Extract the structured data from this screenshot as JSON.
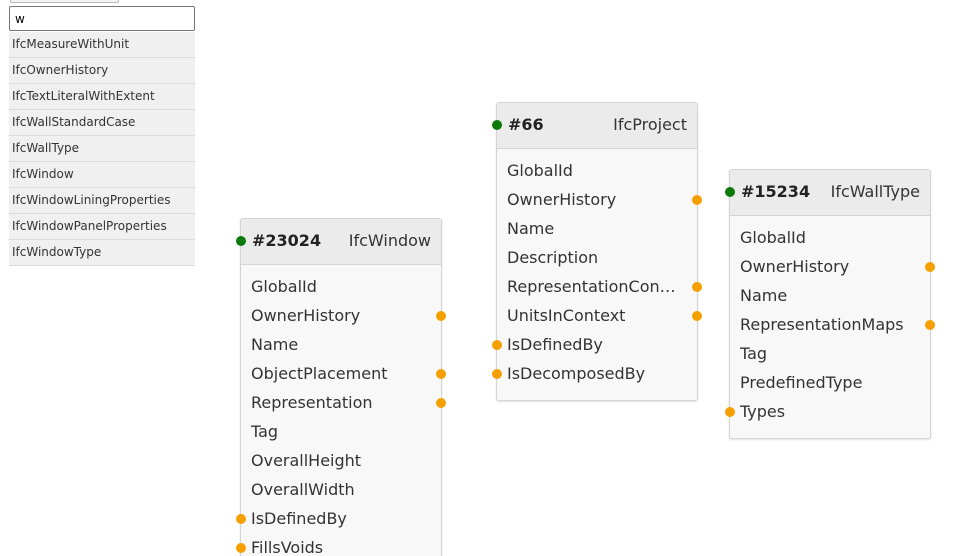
{
  "search": {
    "query": "w",
    "suggestions": [
      "IfcMeasureWithUnit",
      "IfcOwnerHistory",
      "IfcTextLiteralWithExtent",
      "IfcWallStandardCase",
      "IfcWallType",
      "IfcWindow",
      "IfcWindowLiningProperties",
      "IfcWindowPanelProperties",
      "IfcWindowType"
    ]
  },
  "colors": {
    "input_port": "#0a7a0a",
    "attribute_port": "#f5a000"
  },
  "nodes": [
    {
      "id": "#23024",
      "type": "IfcWindow",
      "fields": [
        {
          "name": "GlobalId",
          "port": "none"
        },
        {
          "name": "OwnerHistory",
          "port": "right"
        },
        {
          "name": "Name",
          "port": "none"
        },
        {
          "name": "ObjectPlacement",
          "port": "right"
        },
        {
          "name": "Representation",
          "port": "right"
        },
        {
          "name": "Tag",
          "port": "none"
        },
        {
          "name": "OverallHeight",
          "port": "none"
        },
        {
          "name": "OverallWidth",
          "port": "none"
        },
        {
          "name": "IsDefinedBy",
          "port": "left"
        },
        {
          "name": "FillsVoids",
          "port": "left"
        }
      ]
    },
    {
      "id": "#66",
      "type": "IfcProject",
      "fields": [
        {
          "name": "GlobalId",
          "port": "none"
        },
        {
          "name": "OwnerHistory",
          "port": "right"
        },
        {
          "name": "Name",
          "port": "none"
        },
        {
          "name": "Description",
          "port": "none"
        },
        {
          "name": "RepresentationContexts",
          "port": "right"
        },
        {
          "name": "UnitsInContext",
          "port": "right"
        },
        {
          "name": "IsDefinedBy",
          "port": "left"
        },
        {
          "name": "IsDecomposedBy",
          "port": "left"
        }
      ]
    },
    {
      "id": "#15234",
      "type": "IfcWallType",
      "fields": [
        {
          "name": "GlobalId",
          "port": "none"
        },
        {
          "name": "OwnerHistory",
          "port": "right"
        },
        {
          "name": "Name",
          "port": "none"
        },
        {
          "name": "RepresentationMaps",
          "port": "right"
        },
        {
          "name": "Tag",
          "port": "none"
        },
        {
          "name": "PredefinedType",
          "port": "none"
        },
        {
          "name": "Types",
          "port": "left"
        }
      ]
    }
  ]
}
